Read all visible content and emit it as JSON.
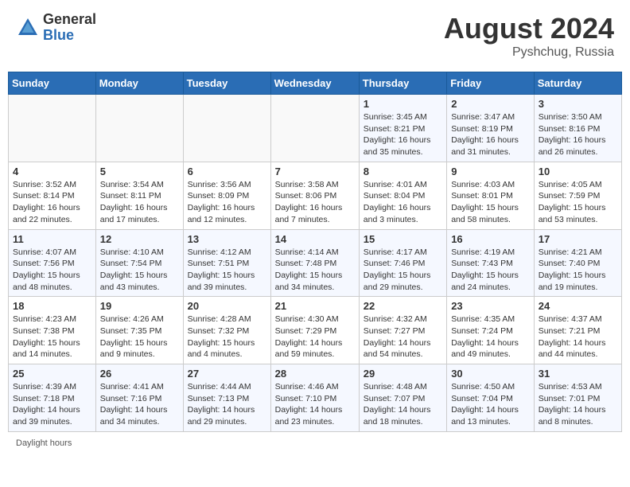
{
  "header": {
    "logo_general": "General",
    "logo_blue": "Blue",
    "month_year": "August 2024",
    "location": "Pyshchug, Russia"
  },
  "days_of_week": [
    "Sunday",
    "Monday",
    "Tuesday",
    "Wednesday",
    "Thursday",
    "Friday",
    "Saturday"
  ],
  "weeks": [
    [
      {
        "day": "",
        "info": ""
      },
      {
        "day": "",
        "info": ""
      },
      {
        "day": "",
        "info": ""
      },
      {
        "day": "",
        "info": ""
      },
      {
        "day": "1",
        "info": "Sunrise: 3:45 AM\nSunset: 8:21 PM\nDaylight: 16 hours and 35 minutes."
      },
      {
        "day": "2",
        "info": "Sunrise: 3:47 AM\nSunset: 8:19 PM\nDaylight: 16 hours and 31 minutes."
      },
      {
        "day": "3",
        "info": "Sunrise: 3:50 AM\nSunset: 8:16 PM\nDaylight: 16 hours and 26 minutes."
      }
    ],
    [
      {
        "day": "4",
        "info": "Sunrise: 3:52 AM\nSunset: 8:14 PM\nDaylight: 16 hours and 22 minutes."
      },
      {
        "day": "5",
        "info": "Sunrise: 3:54 AM\nSunset: 8:11 PM\nDaylight: 16 hours and 17 minutes."
      },
      {
        "day": "6",
        "info": "Sunrise: 3:56 AM\nSunset: 8:09 PM\nDaylight: 16 hours and 12 minutes."
      },
      {
        "day": "7",
        "info": "Sunrise: 3:58 AM\nSunset: 8:06 PM\nDaylight: 16 hours and 7 minutes."
      },
      {
        "day": "8",
        "info": "Sunrise: 4:01 AM\nSunset: 8:04 PM\nDaylight: 16 hours and 3 minutes."
      },
      {
        "day": "9",
        "info": "Sunrise: 4:03 AM\nSunset: 8:01 PM\nDaylight: 15 hours and 58 minutes."
      },
      {
        "day": "10",
        "info": "Sunrise: 4:05 AM\nSunset: 7:59 PM\nDaylight: 15 hours and 53 minutes."
      }
    ],
    [
      {
        "day": "11",
        "info": "Sunrise: 4:07 AM\nSunset: 7:56 PM\nDaylight: 15 hours and 48 minutes."
      },
      {
        "day": "12",
        "info": "Sunrise: 4:10 AM\nSunset: 7:54 PM\nDaylight: 15 hours and 43 minutes."
      },
      {
        "day": "13",
        "info": "Sunrise: 4:12 AM\nSunset: 7:51 PM\nDaylight: 15 hours and 39 minutes."
      },
      {
        "day": "14",
        "info": "Sunrise: 4:14 AM\nSunset: 7:48 PM\nDaylight: 15 hours and 34 minutes."
      },
      {
        "day": "15",
        "info": "Sunrise: 4:17 AM\nSunset: 7:46 PM\nDaylight: 15 hours and 29 minutes."
      },
      {
        "day": "16",
        "info": "Sunrise: 4:19 AM\nSunset: 7:43 PM\nDaylight: 15 hours and 24 minutes."
      },
      {
        "day": "17",
        "info": "Sunrise: 4:21 AM\nSunset: 7:40 PM\nDaylight: 15 hours and 19 minutes."
      }
    ],
    [
      {
        "day": "18",
        "info": "Sunrise: 4:23 AM\nSunset: 7:38 PM\nDaylight: 15 hours and 14 minutes."
      },
      {
        "day": "19",
        "info": "Sunrise: 4:26 AM\nSunset: 7:35 PM\nDaylight: 15 hours and 9 minutes."
      },
      {
        "day": "20",
        "info": "Sunrise: 4:28 AM\nSunset: 7:32 PM\nDaylight: 15 hours and 4 minutes."
      },
      {
        "day": "21",
        "info": "Sunrise: 4:30 AM\nSunset: 7:29 PM\nDaylight: 14 hours and 59 minutes."
      },
      {
        "day": "22",
        "info": "Sunrise: 4:32 AM\nSunset: 7:27 PM\nDaylight: 14 hours and 54 minutes."
      },
      {
        "day": "23",
        "info": "Sunrise: 4:35 AM\nSunset: 7:24 PM\nDaylight: 14 hours and 49 minutes."
      },
      {
        "day": "24",
        "info": "Sunrise: 4:37 AM\nSunset: 7:21 PM\nDaylight: 14 hours and 44 minutes."
      }
    ],
    [
      {
        "day": "25",
        "info": "Sunrise: 4:39 AM\nSunset: 7:18 PM\nDaylight: 14 hours and 39 minutes."
      },
      {
        "day": "26",
        "info": "Sunrise: 4:41 AM\nSunset: 7:16 PM\nDaylight: 14 hours and 34 minutes."
      },
      {
        "day": "27",
        "info": "Sunrise: 4:44 AM\nSunset: 7:13 PM\nDaylight: 14 hours and 29 minutes."
      },
      {
        "day": "28",
        "info": "Sunrise: 4:46 AM\nSunset: 7:10 PM\nDaylight: 14 hours and 23 minutes."
      },
      {
        "day": "29",
        "info": "Sunrise: 4:48 AM\nSunset: 7:07 PM\nDaylight: 14 hours and 18 minutes."
      },
      {
        "day": "30",
        "info": "Sunrise: 4:50 AM\nSunset: 7:04 PM\nDaylight: 14 hours and 13 minutes."
      },
      {
        "day": "31",
        "info": "Sunrise: 4:53 AM\nSunset: 7:01 PM\nDaylight: 14 hours and 8 minutes."
      }
    ]
  ],
  "footer": {
    "daylight_label": "Daylight hours"
  }
}
